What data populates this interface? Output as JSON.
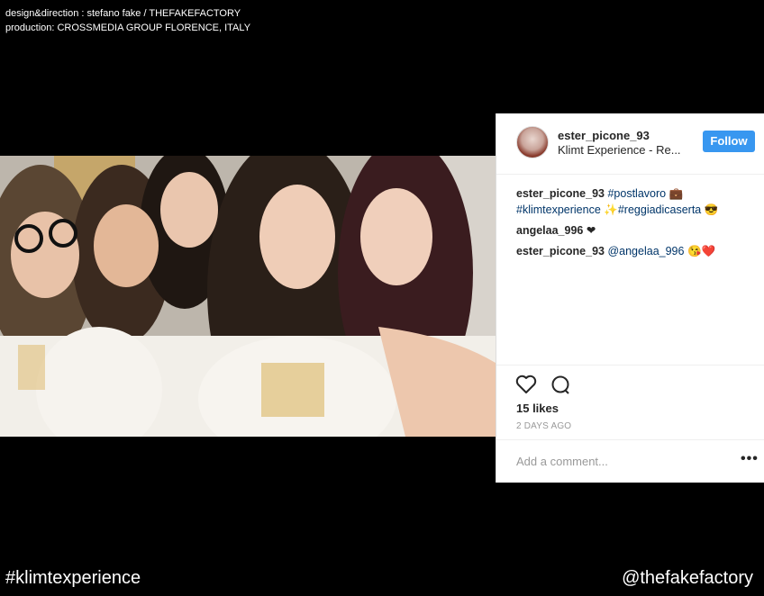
{
  "credits": {
    "line1": "design&direction : stefano fake / THEFAKEFACTORY",
    "line2": "production: CROSSMEDIA GROUP FLORENCE, ITALY"
  },
  "post": {
    "username": "ester_picone_93",
    "location": "Klimt Experience - Re...",
    "follow_label": "Follow",
    "comments": [
      {
        "user": "ester_picone_93",
        "text_parts": [
          "#postlavoro",
          " 💼 ",
          "#klimtexperience",
          " ✨",
          "#reggiadicaserta",
          " 😎"
        ]
      },
      {
        "user": "angelaa_996",
        "text": "❤"
      },
      {
        "user": "ester_picone_93",
        "mention": "@angelaa_996",
        "emoji": " 😘❤️"
      }
    ],
    "likes": "15 likes",
    "time_ago": "2 DAYS AGO",
    "add_comment_placeholder": "Add a comment...",
    "more_icon": "•••"
  },
  "footer": {
    "hashtag": "#klimtexperience",
    "handle": "@thefakefactory"
  },
  "icons": {
    "heart": "heart-icon",
    "comment": "comment-bubble-icon",
    "more": "more-options-icon"
  },
  "colors": {
    "follow_button": "#3897f0",
    "hashtag_link": "#003569",
    "background": "#000000"
  }
}
